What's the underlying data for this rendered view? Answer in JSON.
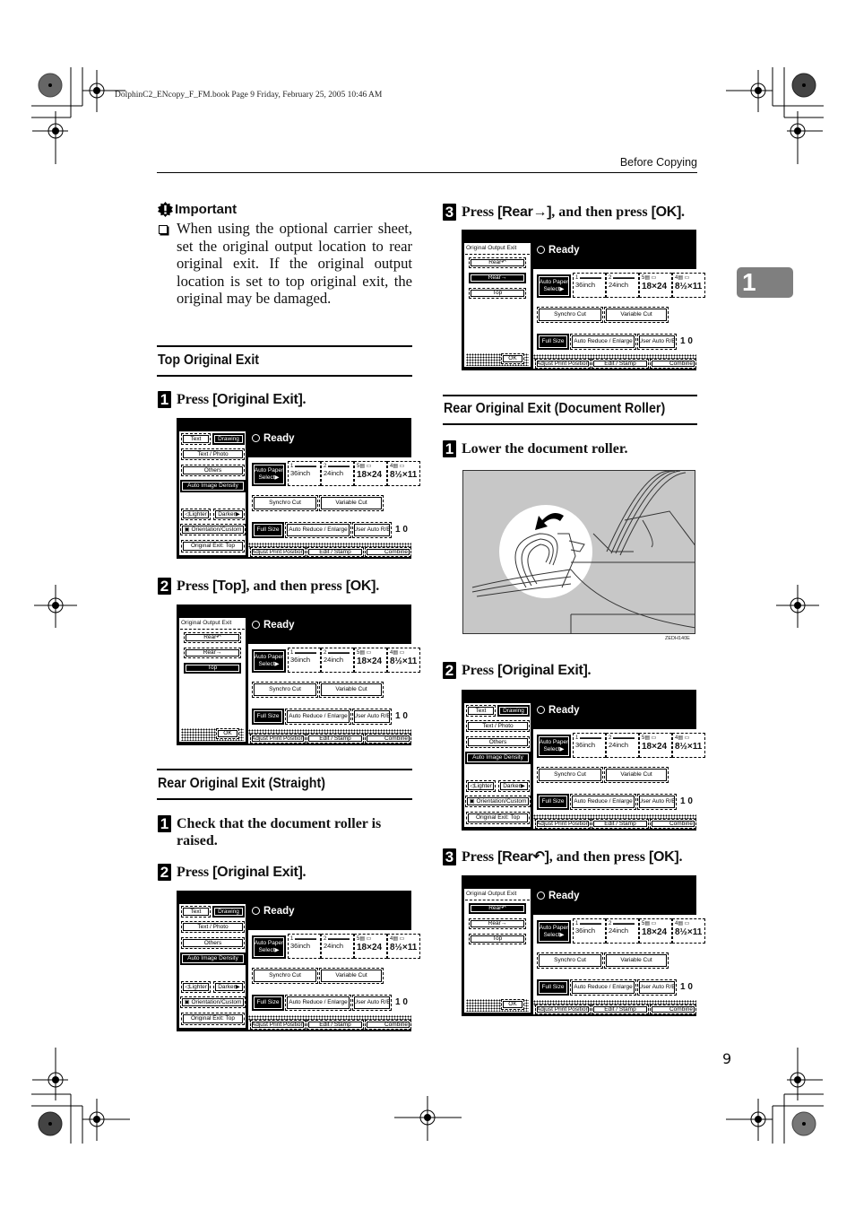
{
  "print_slug": "DolphinC2_ENcopy_F_FM.book  Page 9  Friday, February 25, 2005  10:46 AM",
  "running_head": "Before Copying",
  "chapter_tab": "1",
  "page_number": "9",
  "important": {
    "title": "Important",
    "icon": "important-icon",
    "text": "When using the optional carrier sheet, set the original output location to rear original exit. If the original output location is set to top original exit, the original may be damaged."
  },
  "sections": {
    "top_exit": {
      "title": "Top Original Exit",
      "steps": [
        {
          "num": "1",
          "pre": "Press ",
          "key": "[Original Exit]",
          "post": "."
        },
        {
          "num": "2",
          "pre": "Press ",
          "key": "[Top]",
          "post": ", and then press ",
          "key2": "[OK]",
          "post2": "."
        }
      ]
    },
    "rear_straight": {
      "title": "Rear Original Exit (Straight)",
      "steps": [
        {
          "num": "1",
          "text": "Check that the document roller is raised."
        },
        {
          "num": "2",
          "pre": "Press ",
          "key": "[Original Exit]",
          "post": "."
        },
        {
          "num": "3",
          "pre": "Press ",
          "key": "[Rear→]",
          "post": ", and then press ",
          "key2": "[OK]",
          "post2": "."
        }
      ]
    },
    "rear_roller": {
      "title": "Rear Original Exit (Document Roller)",
      "steps": [
        {
          "num": "1",
          "text": "Lower the document roller."
        },
        {
          "num": "2",
          "pre": "Press ",
          "key": "[Original Exit]",
          "post": "."
        },
        {
          "num": "3",
          "pre": "Press ",
          "key": "[Rear↶]",
          "post": ", and then press ",
          "key2": "[OK]",
          "post2": "."
        }
      ]
    }
  },
  "illustration": {
    "caption": "ZEDH140E"
  },
  "panel": {
    "status": "Ready",
    "mode_text": "Text",
    "mode_drawing": "Drawing",
    "text_photo": "Text / Photo",
    "others": "Others",
    "auto_density": "Auto Image Density",
    "lighter": "◁Lighter",
    "darker": "Darker▶",
    "orientation": "Orientation/Custom",
    "original_exit": "Original Exit: Top",
    "auto_paper": "Auto Paper",
    "auto_paper2": "Select▶",
    "trays": [
      {
        "n": "1 ▬▬▬▬",
        "size": "36inch",
        "big": false
      },
      {
        "n": "2 ▬▬▬▬",
        "size": "24inch",
        "big": false
      },
      {
        "n": "5▤ ▭",
        "size": "18×24",
        "big": true
      },
      {
        "n": "4▤ ▭",
        "size": "8½×11",
        "big": true
      }
    ],
    "synchro_cut": "Synchro Cut",
    "variable_cut": "Variable Cut",
    "full_size": "Full Size",
    "auto_reduce": "Auto Reduce / Enlarge",
    "user_auto": "User Auto R/E",
    "ratio": "1 0",
    "adjust_print": "Adjust Print Position",
    "edit_stamp": "Edit / Stamp",
    "combine": "Combine",
    "exit_dialog": {
      "title": "Original Output Exit",
      "rear_roller": "Rear↶",
      "rear_straight": "Rear→",
      "top": "Top",
      "ok": "OK"
    }
  },
  "screens": [
    {
      "type": "main"
    },
    {
      "type": "exit",
      "selected": "top"
    },
    {
      "type": "main"
    },
    {
      "type": "exit",
      "selected": "rear_straight"
    },
    {
      "type": "main"
    },
    {
      "type": "exit",
      "selected": "rear_roller"
    }
  ]
}
